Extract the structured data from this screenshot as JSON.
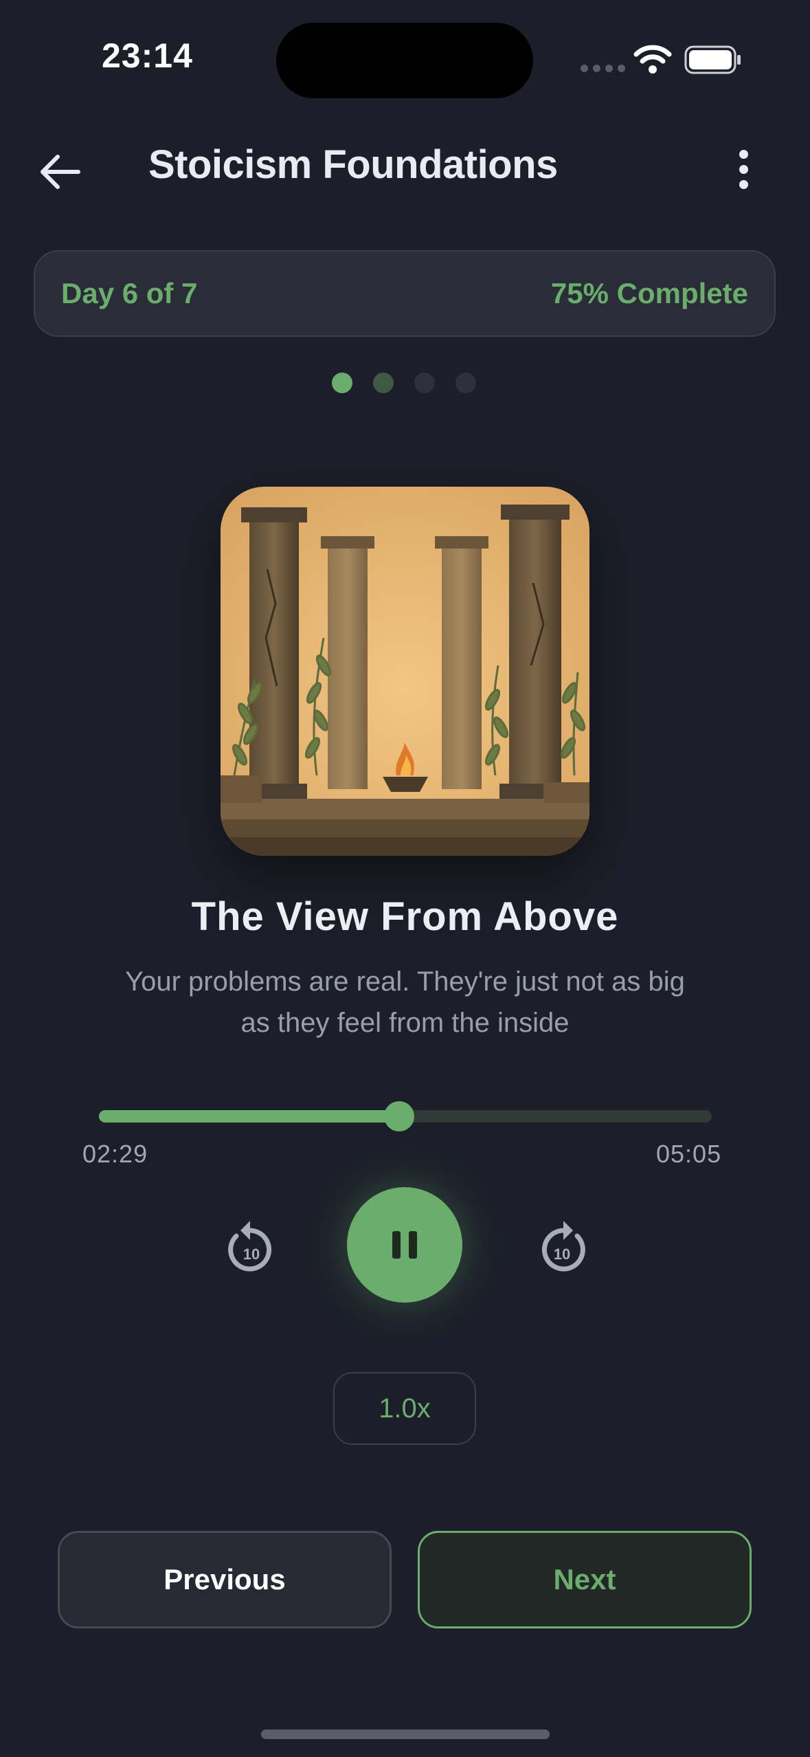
{
  "status_bar": {
    "time": "23:14"
  },
  "header": {
    "title": "Stoicism Foundations"
  },
  "progress": {
    "day_label": "Day 6 of 7",
    "complete_label": "75% Complete"
  },
  "track": {
    "title": "The View From Above",
    "description": "Your problems are real. They're just not as big as they feel from the inside"
  },
  "player": {
    "elapsed": "02:29",
    "total": "05:05",
    "progress_fraction": 0.49,
    "skip_back_seconds": "10",
    "skip_forward_seconds": "10",
    "speed": "1.0x"
  },
  "nav": {
    "previous_label": "Previous",
    "next_label": "Next"
  },
  "colors": {
    "accent": "#6aad6c",
    "background": "#1c1f29",
    "card": "#2a2d37"
  }
}
